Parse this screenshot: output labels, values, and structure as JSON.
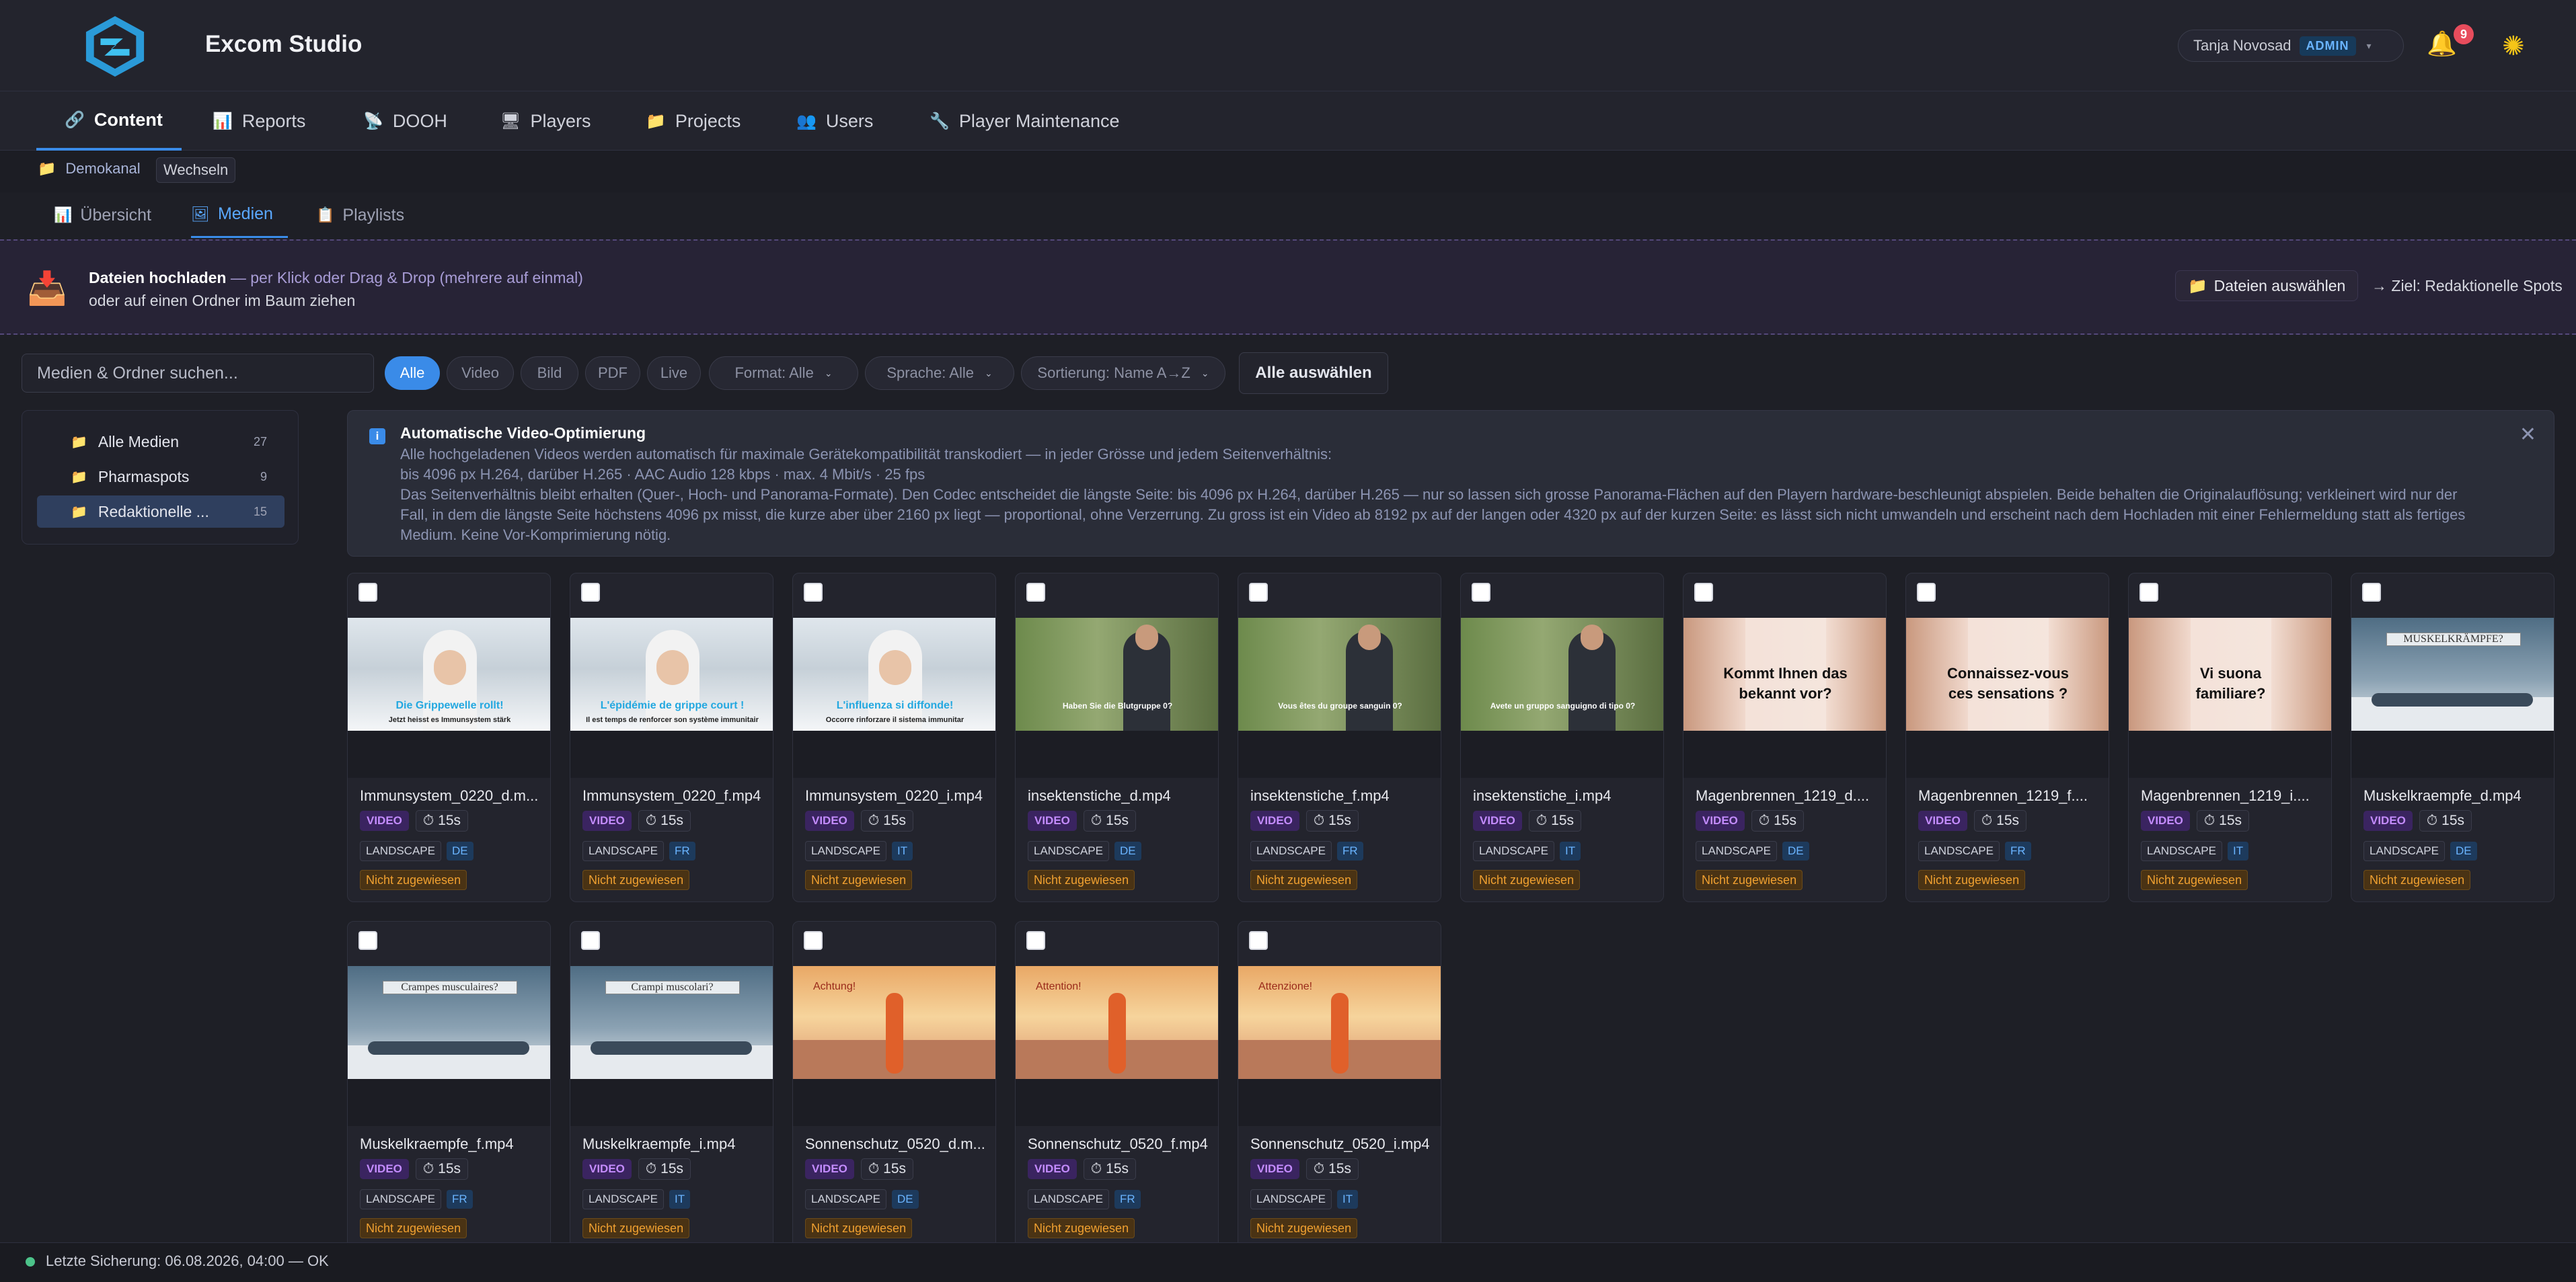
{
  "app": {
    "title": "Excom Studio"
  },
  "user": {
    "name": "Tanja Novosad",
    "role": "ADMIN",
    "notifications": "9"
  },
  "nav": {
    "tabs": [
      {
        "icon": "🔗",
        "label": "Content"
      },
      {
        "icon": "📊",
        "label": "Reports"
      },
      {
        "icon": "📡",
        "label": "DOOH"
      },
      {
        "icon": "🖥",
        "label": "Players"
      },
      {
        "icon": "📁",
        "label": "Projects"
      },
      {
        "icon": "👥",
        "label": "Users"
      },
      {
        "icon": "🔧",
        "label": "Player Maintenance"
      }
    ]
  },
  "breadcrumb": {
    "channel": "Demokanal",
    "switch": "Wechseln"
  },
  "subnav": {
    "tabs": [
      {
        "icon": "📊",
        "label": "Übersicht"
      },
      {
        "icon": "🖼",
        "label": "Medien"
      },
      {
        "icon": "📋",
        "label": "Playlists"
      }
    ]
  },
  "upload": {
    "title": "Dateien hochladen",
    "hint": " — per Klick oder Drag & Drop (mehrere auf einmal)",
    "line2": "oder auf einen Ordner im Baum ziehen",
    "select_button": "Dateien auswählen",
    "target": "→ Ziel: Redaktionelle Spots"
  },
  "filters": {
    "search_placeholder": "Medien & Ordner suchen...",
    "chips": [
      "Alle",
      "Video",
      "Bild",
      "PDF",
      "Live"
    ],
    "format": "Format: Alle",
    "language": "Sprache: Alle",
    "sort": "Sortierung: Name A→Z",
    "select_all": "Alle auswählen"
  },
  "folders": [
    {
      "label": "Alle Medien",
      "count": "27"
    },
    {
      "label": "Pharmaspots",
      "count": "9"
    },
    {
      "label": "Redaktionelle ...",
      "count": "15"
    }
  ],
  "info": {
    "title": "Automatische Video-Optimierung",
    "lines": [
      "Alle hochgeladenen Videos werden automatisch für maximale Gerätekompatibilität transkodiert — in jeder Grösse und jedem Seitenverhältnis:",
      "bis 4096 px H.264, darüber H.265 · AAC Audio 128 kbps · max. 4 Mbit/s · 25 fps",
      "Das Seitenverhältnis bleibt erhalten (Quer-, Hoch- und Panorama-Formate). Den Codec entscheidet die längste Seite: bis 4096 px H.264, darüber H.265 — nur so lassen sich grosse Panorama-Flächen auf den Playern hardware-beschleunigt abspielen. Beide behalten die Originalauflösung; verkleinert wird nur der",
      "Fall, in dem die längste Seite höchstens 4096 px misst, die kurze aber über 2160 px liegt — proportional, ohne Verzerrung. Zu gross ist ein Video ab 8192 px auf der langen oder 4320 px auf der kurzen Seite: es lässt sich nicht umwandeln und erscheint nach dem Hochladen mit einer Fehlermeldung statt als fertiges",
      "Medium. Keine Vor-Komprimierung nötig."
    ]
  },
  "media": [
    {
      "name": "Immunsystem_0220_d.m...",
      "type": "VIDEO",
      "duration": "15s",
      "format": "LANDSCAPE",
      "lang": "DE",
      "status": "Nicht zugewiesen",
      "caption": "Die Grippewelle rollt!",
      "caption2": "Jetzt heisst es Immunsystem stärk"
    },
    {
      "name": "Immunsystem_0220_f.mp4",
      "type": "VIDEO",
      "duration": "15s",
      "format": "LANDSCAPE",
      "lang": "FR",
      "status": "Nicht zugewiesen",
      "caption": "L'épidémie de grippe court !",
      "caption2": "Il est temps de renforcer son système immunitair"
    },
    {
      "name": "Immunsystem_0220_i.mp4",
      "type": "VIDEO",
      "duration": "15s",
      "format": "LANDSCAPE",
      "lang": "IT",
      "status": "Nicht zugewiesen",
      "caption": "L'influenza si diffonde!",
      "caption2": "Occorre rinforzare il sistema immunitar"
    },
    {
      "name": "insektenstiche_d.mp4",
      "type": "VIDEO",
      "duration": "15s",
      "format": "LANDSCAPE",
      "lang": "DE",
      "status": "Nicht zugewiesen",
      "caption": "Haben Sie die Blutgruppe 0?"
    },
    {
      "name": "insektenstiche_f.mp4",
      "type": "VIDEO",
      "duration": "15s",
      "format": "LANDSCAPE",
      "lang": "FR",
      "status": "Nicht zugewiesen",
      "caption": "Vous êtes du groupe sanguin 0?"
    },
    {
      "name": "insektenstiche_i.mp4",
      "type": "VIDEO",
      "duration": "15s",
      "format": "LANDSCAPE",
      "lang": "IT",
      "status": "Nicht zugewiesen",
      "caption": "Avete un gruppo sanguigno di tipo 0?"
    },
    {
      "name": "Magenbrennen_1219_d....",
      "type": "VIDEO",
      "duration": "15s",
      "format": "LANDSCAPE",
      "lang": "DE",
      "status": "Nicht zugewiesen",
      "caption": "Kommt Ihnen das",
      "caption2": "bekannt vor?"
    },
    {
      "name": "Magenbrennen_1219_f....",
      "type": "VIDEO",
      "duration": "15s",
      "format": "LANDSCAPE",
      "lang": "FR",
      "status": "Nicht zugewiesen",
      "caption": "Connaissez-vous",
      "caption2": "ces sensations ?"
    },
    {
      "name": "Magenbrennen_1219_i....",
      "type": "VIDEO",
      "duration": "15s",
      "format": "LANDSCAPE",
      "lang": "IT",
      "status": "Nicht zugewiesen",
      "caption": "Vi suona",
      "caption2": "familiare?"
    },
    {
      "name": "Muskelkraempfe_d.mp4",
      "type": "VIDEO",
      "duration": "15s",
      "format": "LANDSCAPE",
      "lang": "DE",
      "status": "Nicht zugewiesen",
      "caption": "MUSKELKRÄMPFE?"
    },
    {
      "name": "Muskelkraempfe_f.mp4",
      "type": "VIDEO",
      "duration": "15s",
      "format": "LANDSCAPE",
      "lang": "FR",
      "status": "Nicht zugewiesen",
      "caption": "Crampes musculaires?"
    },
    {
      "name": "Muskelkraempfe_i.mp4",
      "type": "VIDEO",
      "duration": "15s",
      "format": "LANDSCAPE",
      "lang": "IT",
      "status": "Nicht zugewiesen",
      "caption": "Crampi muscolari?"
    },
    {
      "name": "Sonnenschutz_0520_d.m...",
      "type": "VIDEO",
      "duration": "15s",
      "format": "LANDSCAPE",
      "lang": "DE",
      "status": "Nicht zugewiesen",
      "caption": "Achtung!"
    },
    {
      "name": "Sonnenschutz_0520_f.mp4",
      "type": "VIDEO",
      "duration": "15s",
      "format": "LANDSCAPE",
      "lang": "FR",
      "status": "Nicht zugewiesen",
      "caption": "Attention!"
    },
    {
      "name": "Sonnenschutz_0520_i.mp4",
      "type": "VIDEO",
      "duration": "15s",
      "format": "LANDSCAPE",
      "lang": "IT",
      "status": "Nicht zugewiesen",
      "caption": "Attenzione!"
    }
  ],
  "footer": {
    "status": "Letzte Sicherung: 06.08.2026, 04:00 — OK"
  }
}
